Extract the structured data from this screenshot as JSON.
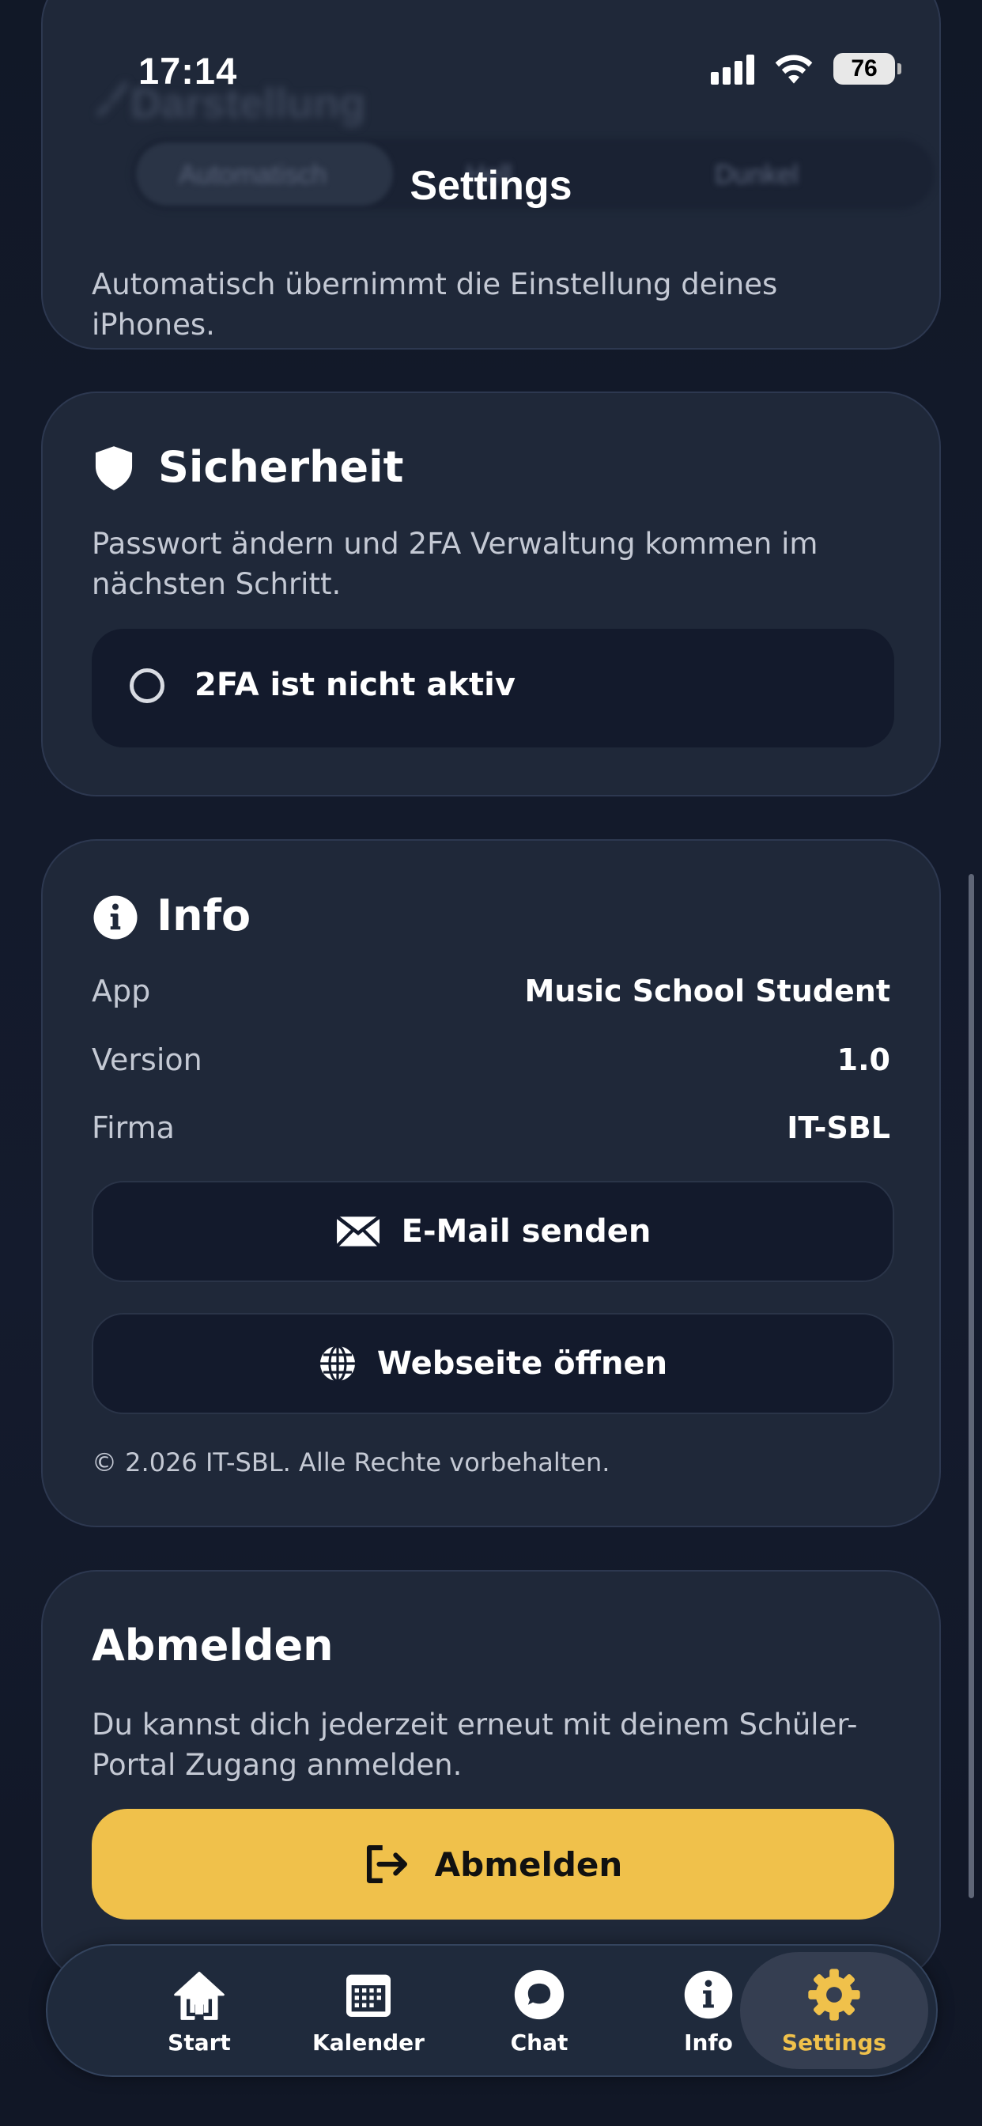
{
  "status_bar": {
    "time": "17:14",
    "battery": "76"
  },
  "header": {
    "title": "Settings"
  },
  "appearance": {
    "title": "Darstellung",
    "options": [
      "Automatisch",
      "Hell",
      "Dunkel"
    ],
    "selected": "Automatisch",
    "description": "Automatisch übernimmt die Einstellung deines iPhones."
  },
  "security": {
    "title": "Sicherheit",
    "description": "Passwort ändern und 2FA Verwaltung kommen im nächsten Schritt.",
    "twofa_status": "2FA ist nicht aktiv"
  },
  "info": {
    "title": "Info",
    "rows": [
      {
        "label": "App",
        "value": "Music School Student"
      },
      {
        "label": "Version",
        "value": "1.0"
      },
      {
        "label": "Firma",
        "value": "IT-SBL"
      }
    ],
    "email_button": "E-Mail senden",
    "website_button": "Webseite öffnen",
    "copyright": "© 2.026 IT-SBL. Alle Rechte vorbehalten."
  },
  "logout": {
    "title": "Abmelden",
    "description": "Du kannst dich jederzeit erneut mit deinem Schüler-Portal Zugang anmelden.",
    "button": "Abmelden"
  },
  "tabbar": {
    "items": [
      {
        "label": "Start",
        "icon": "home-icon"
      },
      {
        "label": "Kalender",
        "icon": "calendar-icon"
      },
      {
        "label": "Chat",
        "icon": "chat-icon"
      },
      {
        "label": "Info",
        "icon": "info-icon"
      },
      {
        "label": "Settings",
        "icon": "gear-icon"
      }
    ],
    "active": "Settings",
    "active_color": "#f0c14b"
  },
  "colors": {
    "accent": "#f0c14b",
    "card": "#1f2839",
    "background": "#111827"
  }
}
